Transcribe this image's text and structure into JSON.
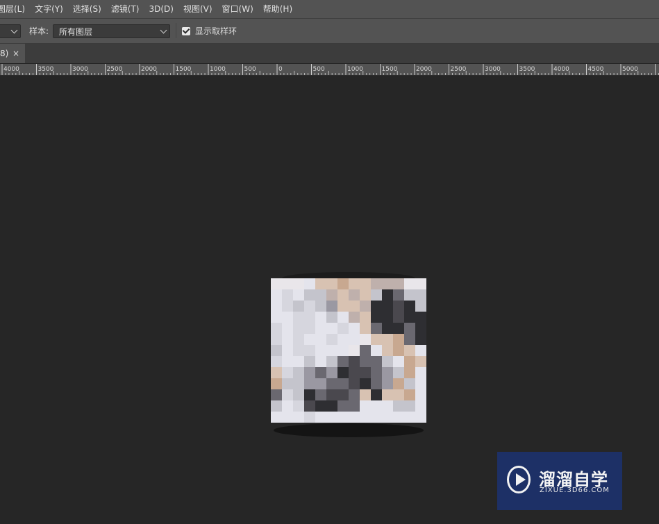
{
  "menu": {
    "items": [
      "图层(L)",
      "文字(Y)",
      "选择(S)",
      "滤镜(T)",
      "3D(D)",
      "视图(V)",
      "窗口(W)",
      "帮助(H)"
    ]
  },
  "options": {
    "sample_label": "样本:",
    "sample_value": "所有图层",
    "show_ring_label": "显示取样环",
    "show_ring_checked": true
  },
  "tab": {
    "title": "8)",
    "close": "×"
  },
  "ruler": {
    "labels": [
      "4000",
      "3500",
      "3000",
      "2500",
      "2000",
      "1500",
      "1000",
      "500",
      "0",
      "500",
      "1000",
      "1500",
      "2000",
      "2500",
      "3000",
      "3500",
      "4000",
      "4500",
      "5000"
    ]
  },
  "watermark": {
    "title": "溜溜自学",
    "subtitle": "ZIXUE.3D66.COM"
  },
  "colors": {
    "menu_bg": "#535353",
    "canvas_bg": "#262626",
    "accent": "#2f7fd8"
  }
}
